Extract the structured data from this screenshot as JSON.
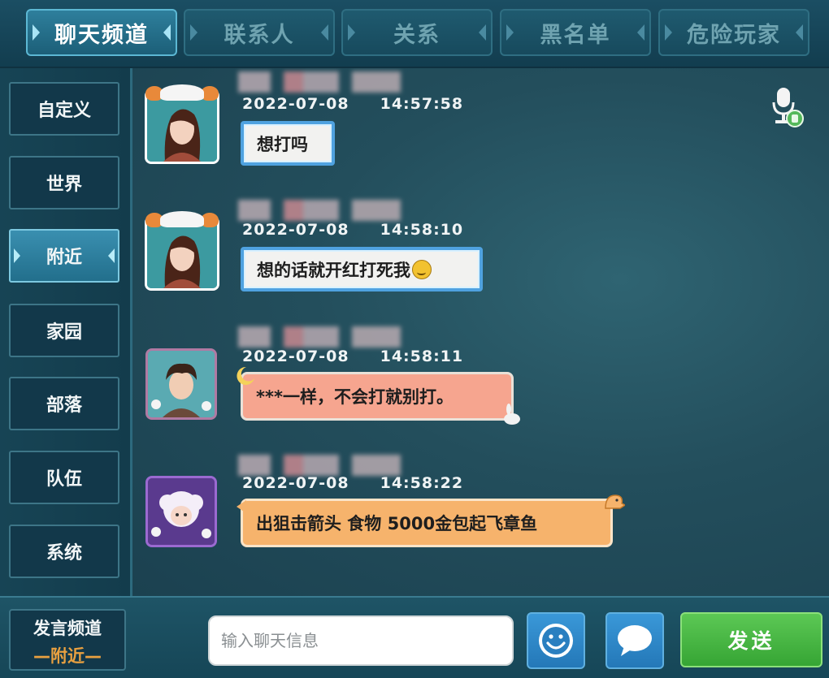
{
  "tabs": [
    {
      "label": "聊天频道",
      "active": true
    },
    {
      "label": "联系人",
      "active": false
    },
    {
      "label": "关系",
      "active": false
    },
    {
      "label": "黑名单",
      "active": false
    },
    {
      "label": "危险玩家",
      "active": false
    }
  ],
  "sidebar": {
    "items": [
      {
        "label": "自定义",
        "active": false
      },
      {
        "label": "世界",
        "active": false
      },
      {
        "label": "附近",
        "active": true
      },
      {
        "label": "家园",
        "active": false
      },
      {
        "label": "部落",
        "active": false
      },
      {
        "label": "队伍",
        "active": false
      },
      {
        "label": "系统",
        "active": false
      }
    ]
  },
  "messages": [
    {
      "datetime": "2022-07-08     14:57:58",
      "text": "想打吗",
      "style": "blue",
      "avatar": "girl-panda-hat"
    },
    {
      "datetime": "2022-07-08     14:58:10",
      "text": "想的话就开红打死我",
      "emoji": "smirk-emoji",
      "style": "blue",
      "avatar": "girl-panda-hat"
    },
    {
      "datetime": "2022-07-08     14:58:11",
      "text": "***一样，不会打就别打。",
      "style": "salmon",
      "avatar": "boy-brown-hair"
    },
    {
      "datetime": "2022-07-08     14:58:22",
      "text": "出狙击箭头 食物 5000金包起飞章鱼",
      "style": "orange",
      "avatar": "sheep-character"
    }
  ],
  "bottom": {
    "channel_title": "发言频道",
    "channel_value": "—附近—",
    "input_placeholder": "输入聊天信息",
    "emoji_button": "smile-icon",
    "chat_button": "speech-bubble-icon",
    "send_label": "发送"
  },
  "colors": {
    "accent_blue": "#4fa2e0",
    "send_green": "#36a534",
    "channel_orange": "#e8a040"
  }
}
